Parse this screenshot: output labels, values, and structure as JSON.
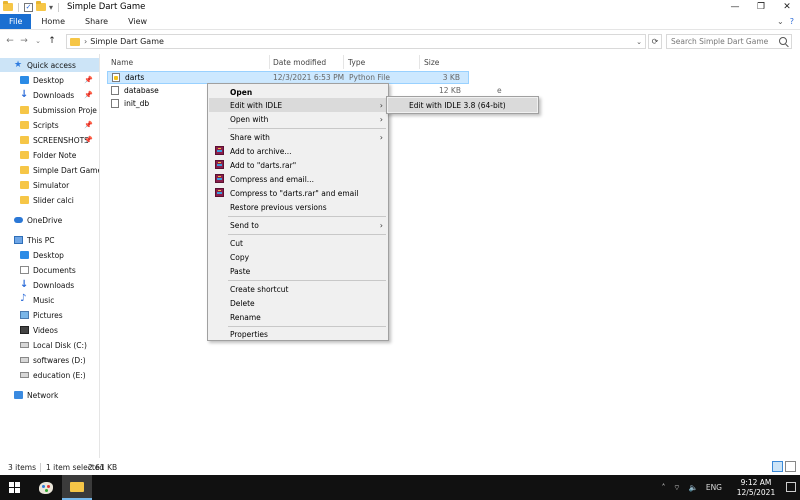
{
  "window": {
    "title": "Simple Dart Game",
    "controls": {
      "minimize": "—",
      "maximize": "❐",
      "close": "✕"
    }
  },
  "ribbon": {
    "tabs": [
      "File",
      "Home",
      "Share",
      "View"
    ],
    "expand": "⌄",
    "help": "?"
  },
  "address": {
    "back": "←",
    "forward": "→",
    "recent": "⌄",
    "up": "↑",
    "chevron": "›",
    "path": "Simple Dart Game",
    "dropdown": "⌄",
    "refresh": "⟳",
    "search_placeholder": "Search Simple Dart Game"
  },
  "nav": {
    "quick_access": "Quick access",
    "quick_items": [
      "Desktop",
      "Downloads",
      "Submission Proje",
      "Scripts",
      "SCREENSHOTS",
      "Folder Note",
      "Simple Dart Game",
      "Simulator",
      "Slider calci"
    ],
    "onedrive": "OneDrive",
    "this_pc": "This PC",
    "pc_items": [
      "Desktop",
      "Documents",
      "Downloads",
      "Music",
      "Pictures",
      "Videos",
      "Local Disk (C:)",
      "softwares (D:)",
      "education (E:)"
    ],
    "network": "Network"
  },
  "columns": {
    "name": "Name",
    "date": "Date modified",
    "type": "Type",
    "size": "Size"
  },
  "files": [
    {
      "name": "darts",
      "date": "12/3/2021 6:53 PM",
      "type": "Python File",
      "size": "3 KB"
    },
    {
      "name": "database",
      "date": "",
      "type": "e",
      "size": "12 KB"
    },
    {
      "name": "init_db",
      "date": "",
      "type": "",
      "size": ""
    }
  ],
  "context_menu": {
    "open": "Open",
    "edit_idle": "Edit with IDLE",
    "open_with": "Open with",
    "share_with": "Share with",
    "add_archive": "Add to archive...",
    "add_rar": "Add to \"darts.rar\"",
    "compress_email": "Compress and email...",
    "compress_rar_email": "Compress to \"darts.rar\" and email",
    "restore": "Restore previous versions",
    "send_to": "Send to",
    "cut": "Cut",
    "copy": "Copy",
    "paste": "Paste",
    "create_shortcut": "Create shortcut",
    "delete": "Delete",
    "rename": "Rename",
    "properties": "Properties",
    "arrow": "›"
  },
  "submenu": {
    "item": "Edit with IDLE 3.8 (64-bit)"
  },
  "status": {
    "count": "3 items",
    "selected": "1 item selected",
    "size": "2.61 KB"
  },
  "taskbar": {
    "tray_up": "˄",
    "tray_net": "⌔",
    "tray_vol": "🔈",
    "lang": "ENG",
    "time": "9:12 AM",
    "date": "12/5/2021"
  }
}
